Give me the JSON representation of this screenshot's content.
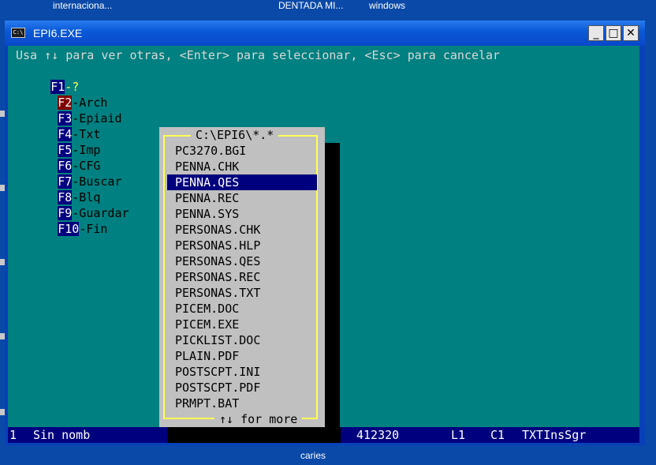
{
  "desktop": {
    "labels": [
      "internaciona...",
      "DENTADA MI...",
      "windows",
      "caries"
    ]
  },
  "window": {
    "title": "EPI6.EXE",
    "icon_text": "C:\\",
    "controls": [
      "_",
      "□",
      "✕"
    ]
  },
  "console": {
    "hint": "Usa ↑↓ para ver otras, <Enter> para seleccionar, <Esc> para cancelar",
    "fkeys": [
      {
        "key": "F1",
        "label": "-?"
      },
      {
        "key": "F2",
        "label": "-Arch"
      },
      {
        "key": "F3",
        "label": "-Epiaid"
      },
      {
        "key": "F4",
        "label": "-Txt"
      },
      {
        "key": "F5",
        "label": "-Imp"
      },
      {
        "key": "F6",
        "label": "-CFG"
      },
      {
        "key": "F7",
        "label": "-Buscar"
      },
      {
        "key": "F8",
        "label": "-Blq"
      },
      {
        "key": "F9",
        "label": "-Guardar"
      },
      {
        "key": "F10",
        "label": "-Fin"
      }
    ]
  },
  "dialog": {
    "title": "C:\\EPI6\\*.*",
    "footer": "↑↓ for more",
    "files": [
      "PC3270.BGI",
      "PENNA.CHK",
      "PENNA.QES",
      "PENNA.REC",
      "PENNA.SYS",
      "PERSONAS.CHK",
      "PERSONAS.HLP",
      "PERSONAS.QES",
      "PERSONAS.REC",
      "PERSONAS.TXT",
      "PICEM.DOC",
      "PICEM.EXE",
      "PICKLIST.DOC",
      "PLAIN.PDF",
      "POSTSCPT.INI",
      "POSTSCPT.PDF",
      "PRMPT.BAT"
    ],
    "selected": "PENNA.QES"
  },
  "status": {
    "window_num": "1",
    "doc_name": "Sin nomb",
    "memory": "412320",
    "line": "L1",
    "col": "C1",
    "mode": "TXTInsSgr"
  }
}
